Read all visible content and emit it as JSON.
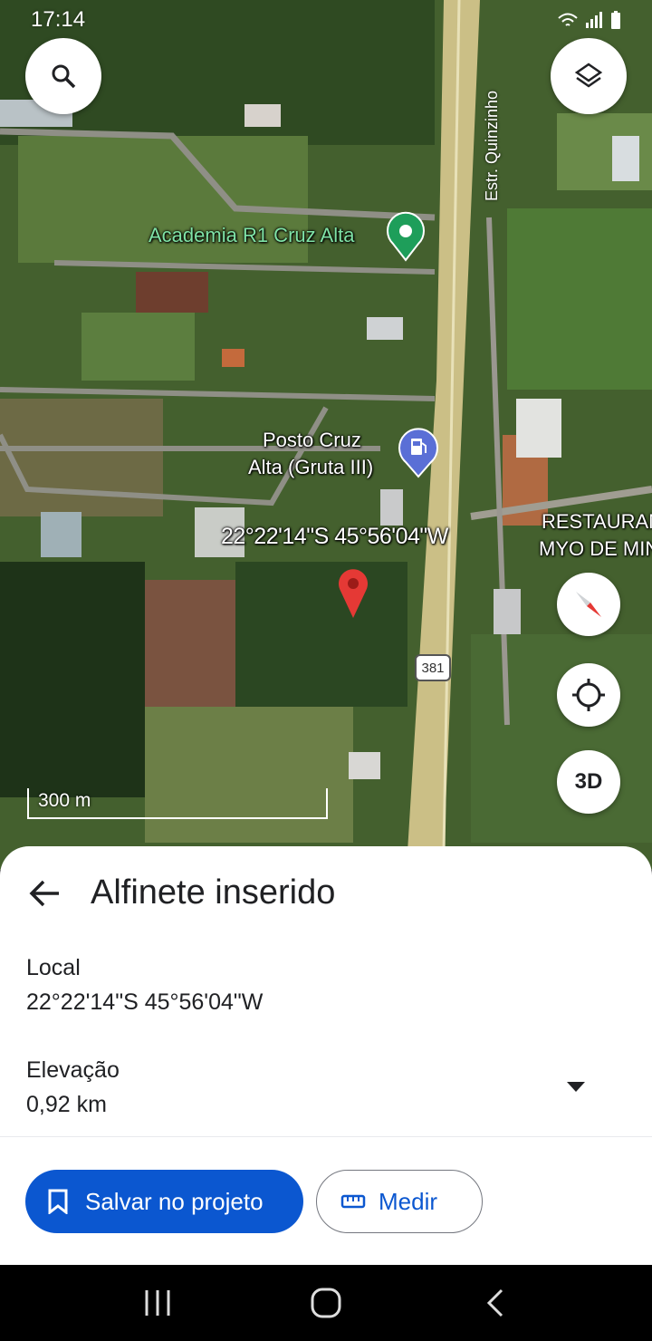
{
  "status_bar": {
    "time": "17:14"
  },
  "map": {
    "labels": {
      "road_name": "Estr. Quinzinho",
      "academia": "Academia R1 Cruz Alta",
      "posto_line1": "Posto Cruz",
      "posto_line2": "Alta (Gruta III)",
      "restaurant_line1": "RESTAURAN",
      "restaurant_line2": "MYO DE MIN",
      "coordinates": "22°22'14\"S 45°56'04\"W",
      "route_number": "381"
    },
    "scale_text": "300 m",
    "three_d_label": "3D",
    "icons": [
      "search-icon",
      "layers-icon",
      "compass-icon",
      "my-location-icon",
      "red-pin-icon",
      "green-pin-icon",
      "gas-station-icon"
    ]
  },
  "sheet": {
    "title": "Alfinete inserido",
    "location_label": "Local",
    "location_value": "22°22'14\"S 45°56'04\"W",
    "elevation_label": "Elevação",
    "elevation_value": "0,92 km",
    "save_button": "Salvar no projeto",
    "measure_button": "Medir"
  },
  "colors": {
    "primary": "#0b57d0",
    "pin_red": "#e53935",
    "pin_green": "#1e9e5a",
    "gas_purple": "#5a6fd6"
  }
}
